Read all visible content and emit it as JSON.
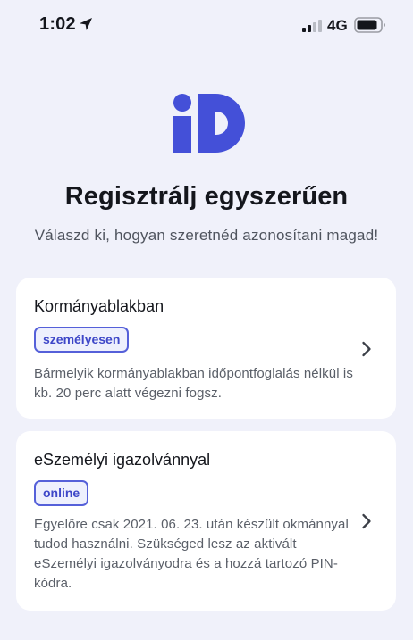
{
  "status_bar": {
    "time": "1:02",
    "network": "4G"
  },
  "header": {
    "logo_text": "iD",
    "title": "Regisztrálj egyszerűen",
    "subtitle": "Válaszd ki, hogyan szeretnéd azonosítani magad!"
  },
  "options": [
    {
      "title": "Kormányablakban",
      "tag": "személyesen",
      "description": "Bármelyik kormányablakban időpontfoglalás nélkül is kb. 20 perc alatt végezni fogsz."
    },
    {
      "title": "eSzemélyi igazolvánnyal",
      "tag": "online",
      "description": "Egyelőre csak 2021. 06. 23. után készült okmánnyal tudod használni. Szükséged lesz az aktivált eSzemélyi igazolványodra és a hozzá tartozó PIN-kódra."
    }
  ],
  "colors": {
    "background": "#f0f1fa",
    "brand": "#4450d8",
    "card": "#ffffff",
    "tag_border": "#5560d9",
    "tag_text": "#3e47c8"
  },
  "icons": {
    "location": "location-arrow-icon",
    "signal": "cellular-signal-icon",
    "battery": "battery-icon",
    "chevron": "chevron-right-icon"
  }
}
